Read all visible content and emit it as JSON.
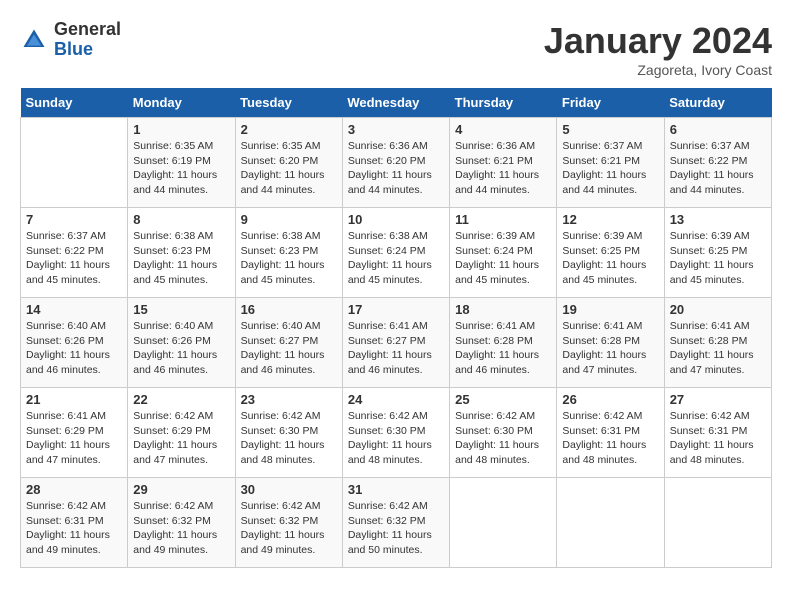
{
  "logo": {
    "general": "General",
    "blue": "Blue"
  },
  "title": "January 2024",
  "subtitle": "Zagoreta, Ivory Coast",
  "days_header": [
    "Sunday",
    "Monday",
    "Tuesday",
    "Wednesday",
    "Thursday",
    "Friday",
    "Saturday"
  ],
  "weeks": [
    [
      {
        "day": "",
        "info": ""
      },
      {
        "day": "1",
        "info": "Sunrise: 6:35 AM\nSunset: 6:19 PM\nDaylight: 11 hours\nand 44 minutes."
      },
      {
        "day": "2",
        "info": "Sunrise: 6:35 AM\nSunset: 6:20 PM\nDaylight: 11 hours\nand 44 minutes."
      },
      {
        "day": "3",
        "info": "Sunrise: 6:36 AM\nSunset: 6:20 PM\nDaylight: 11 hours\nand 44 minutes."
      },
      {
        "day": "4",
        "info": "Sunrise: 6:36 AM\nSunset: 6:21 PM\nDaylight: 11 hours\nand 44 minutes."
      },
      {
        "day": "5",
        "info": "Sunrise: 6:37 AM\nSunset: 6:21 PM\nDaylight: 11 hours\nand 44 minutes."
      },
      {
        "day": "6",
        "info": "Sunrise: 6:37 AM\nSunset: 6:22 PM\nDaylight: 11 hours\nand 44 minutes."
      }
    ],
    [
      {
        "day": "7",
        "info": "Sunrise: 6:37 AM\nSunset: 6:22 PM\nDaylight: 11 hours\nand 45 minutes."
      },
      {
        "day": "8",
        "info": "Sunrise: 6:38 AM\nSunset: 6:23 PM\nDaylight: 11 hours\nand 45 minutes."
      },
      {
        "day": "9",
        "info": "Sunrise: 6:38 AM\nSunset: 6:23 PM\nDaylight: 11 hours\nand 45 minutes."
      },
      {
        "day": "10",
        "info": "Sunrise: 6:38 AM\nSunset: 6:24 PM\nDaylight: 11 hours\nand 45 minutes."
      },
      {
        "day": "11",
        "info": "Sunrise: 6:39 AM\nSunset: 6:24 PM\nDaylight: 11 hours\nand 45 minutes."
      },
      {
        "day": "12",
        "info": "Sunrise: 6:39 AM\nSunset: 6:25 PM\nDaylight: 11 hours\nand 45 minutes."
      },
      {
        "day": "13",
        "info": "Sunrise: 6:39 AM\nSunset: 6:25 PM\nDaylight: 11 hours\nand 45 minutes."
      }
    ],
    [
      {
        "day": "14",
        "info": "Sunrise: 6:40 AM\nSunset: 6:26 PM\nDaylight: 11 hours\nand 46 minutes."
      },
      {
        "day": "15",
        "info": "Sunrise: 6:40 AM\nSunset: 6:26 PM\nDaylight: 11 hours\nand 46 minutes."
      },
      {
        "day": "16",
        "info": "Sunrise: 6:40 AM\nSunset: 6:27 PM\nDaylight: 11 hours\nand 46 minutes."
      },
      {
        "day": "17",
        "info": "Sunrise: 6:41 AM\nSunset: 6:27 PM\nDaylight: 11 hours\nand 46 minutes."
      },
      {
        "day": "18",
        "info": "Sunrise: 6:41 AM\nSunset: 6:28 PM\nDaylight: 11 hours\nand 46 minutes."
      },
      {
        "day": "19",
        "info": "Sunrise: 6:41 AM\nSunset: 6:28 PM\nDaylight: 11 hours\nand 47 minutes."
      },
      {
        "day": "20",
        "info": "Sunrise: 6:41 AM\nSunset: 6:28 PM\nDaylight: 11 hours\nand 47 minutes."
      }
    ],
    [
      {
        "day": "21",
        "info": "Sunrise: 6:41 AM\nSunset: 6:29 PM\nDaylight: 11 hours\nand 47 minutes."
      },
      {
        "day": "22",
        "info": "Sunrise: 6:42 AM\nSunset: 6:29 PM\nDaylight: 11 hours\nand 47 minutes."
      },
      {
        "day": "23",
        "info": "Sunrise: 6:42 AM\nSunset: 6:30 PM\nDaylight: 11 hours\nand 48 minutes."
      },
      {
        "day": "24",
        "info": "Sunrise: 6:42 AM\nSunset: 6:30 PM\nDaylight: 11 hours\nand 48 minutes."
      },
      {
        "day": "25",
        "info": "Sunrise: 6:42 AM\nSunset: 6:30 PM\nDaylight: 11 hours\nand 48 minutes."
      },
      {
        "day": "26",
        "info": "Sunrise: 6:42 AM\nSunset: 6:31 PM\nDaylight: 11 hours\nand 48 minutes."
      },
      {
        "day": "27",
        "info": "Sunrise: 6:42 AM\nSunset: 6:31 PM\nDaylight: 11 hours\nand 48 minutes."
      }
    ],
    [
      {
        "day": "28",
        "info": "Sunrise: 6:42 AM\nSunset: 6:31 PM\nDaylight: 11 hours\nand 49 minutes."
      },
      {
        "day": "29",
        "info": "Sunrise: 6:42 AM\nSunset: 6:32 PM\nDaylight: 11 hours\nand 49 minutes."
      },
      {
        "day": "30",
        "info": "Sunrise: 6:42 AM\nSunset: 6:32 PM\nDaylight: 11 hours\nand 49 minutes."
      },
      {
        "day": "31",
        "info": "Sunrise: 6:42 AM\nSunset: 6:32 PM\nDaylight: 11 hours\nand 50 minutes."
      },
      {
        "day": "",
        "info": ""
      },
      {
        "day": "",
        "info": ""
      },
      {
        "day": "",
        "info": ""
      }
    ]
  ]
}
